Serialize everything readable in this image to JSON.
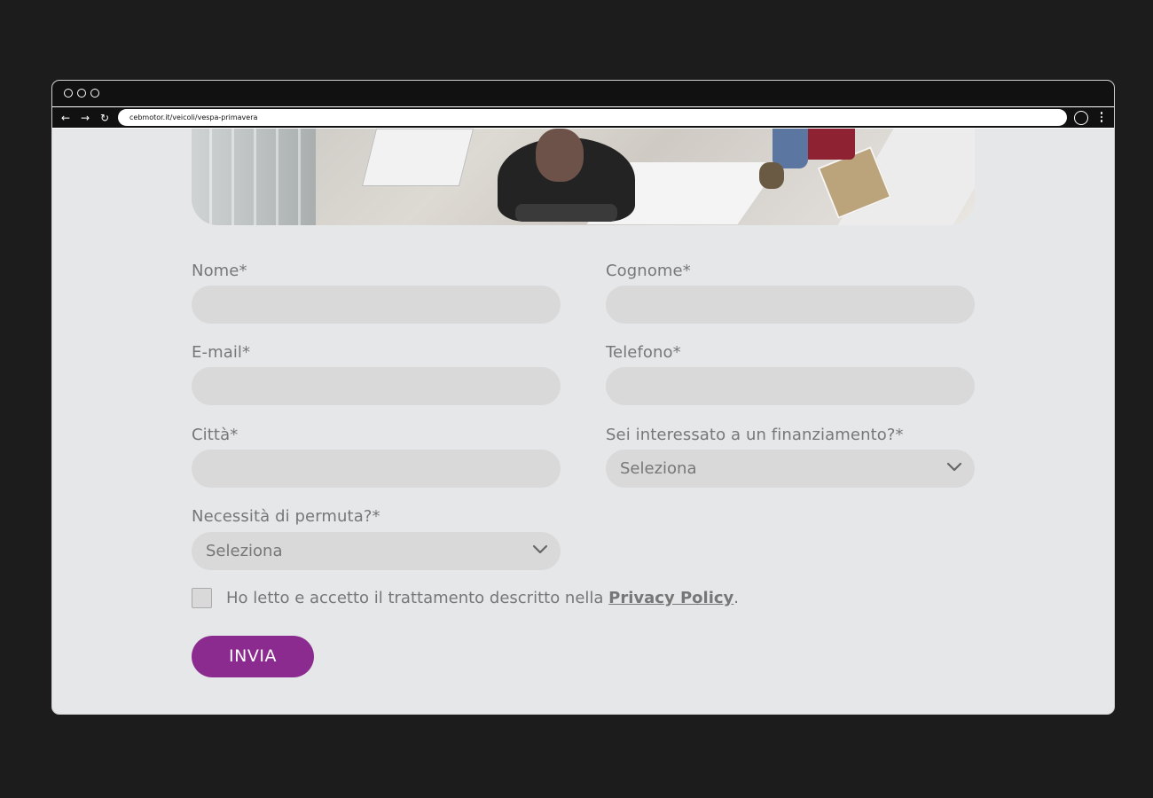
{
  "browser": {
    "url": "cebmotor.it/veicoli/vespa-primavera"
  },
  "form": {
    "nome_label": "Nome*",
    "cognome_label": "Cognome*",
    "email_label": "E-mail*",
    "telefono_label": "Telefono*",
    "citta_label": "Città*",
    "finanziamento_label": "Sei interessato a un finanziamento?*",
    "finanziamento_value": "Seleziona",
    "permuta_label": "Necessità di permuta?*",
    "permuta_value": "Seleziona",
    "consent_text": "Ho letto e accetto il trattamento descritto nella ",
    "privacy_link": "Privacy Policy",
    "consent_end": ".",
    "submit_label": "INVIA"
  },
  "colors": {
    "accent": "#8c2b8f",
    "page_bg": "#e6e7e9",
    "field_bg": "#d9d9d9"
  }
}
